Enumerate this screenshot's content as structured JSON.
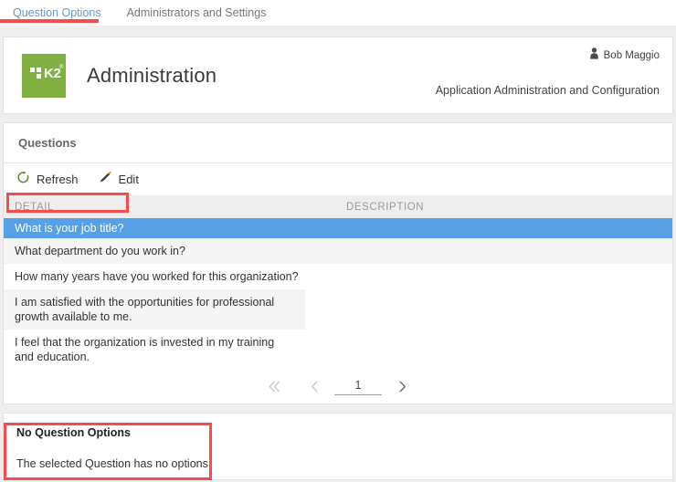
{
  "tabs": [
    {
      "label": "Question Options",
      "active": true
    },
    {
      "label": "Administrators and Settings",
      "active": false
    }
  ],
  "header": {
    "logo_text": "K2",
    "logo_tm": "®",
    "title": "Administration",
    "user_name": "Bob Maggio",
    "subtitle": "Application Administration and Configuration",
    "logo_color": "#7fb041"
  },
  "questions_panel": {
    "title": "Questions",
    "toolbar": {
      "refresh_label": "Refresh",
      "edit_label": "Edit"
    },
    "columns": [
      "DETAIL",
      "DESCRIPTION"
    ],
    "rows": [
      {
        "detail": "What is your job title?",
        "description": "",
        "selected": true
      },
      {
        "detail": "What department do you work in?",
        "description": "",
        "selected": false
      },
      {
        "detail": "How many years have you worked for this organization?",
        "description": "",
        "selected": false
      },
      {
        "detail": "I am satisfied with the opportunities for professional growth available to me.",
        "description": "",
        "selected": false
      },
      {
        "detail": "I feel that the organization is invested in my training and education.",
        "description": "",
        "selected": false
      }
    ],
    "pagination": {
      "first_icon": "chevron-double-left-icon",
      "prev_icon": "chevron-left-icon",
      "page": "1",
      "next_icon": "chevron-right-icon"
    }
  },
  "options_panel": {
    "title": "No Question Options",
    "message": "The selected Question has no options."
  },
  "colors": {
    "accent_blue": "#5b9bd5",
    "selected_row": "#57a0e5",
    "annotation_red": "#f94b4b",
    "brand_green": "#7fb041"
  }
}
